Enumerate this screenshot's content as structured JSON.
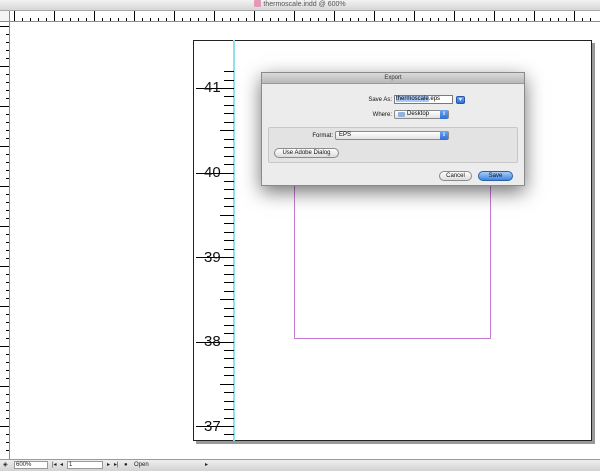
{
  "window": {
    "title": "thermoscale.indd @ 600%"
  },
  "document": {
    "scale_labels": [
      "41",
      "40",
      "39",
      "38",
      "37"
    ]
  },
  "dialog": {
    "title": "Export",
    "save_as_label": "Save As:",
    "save_as_value_selected": "thermoscale",
    "save_as_value_rest": ".eps",
    "where_label": "Where:",
    "where_value": "Desktop",
    "format_label": "Format:",
    "format_value": "EPS",
    "adobe_dialog_button": "Use Adobe Dialog",
    "cancel_button": "Cancel",
    "save_button": "Save"
  },
  "statusbar": {
    "zoom": "600%",
    "page": "1",
    "status": "Open"
  },
  "colors": {
    "guide": "#8fe3e8",
    "frame": "#c77ad4",
    "default_button": "#3e86e3"
  }
}
